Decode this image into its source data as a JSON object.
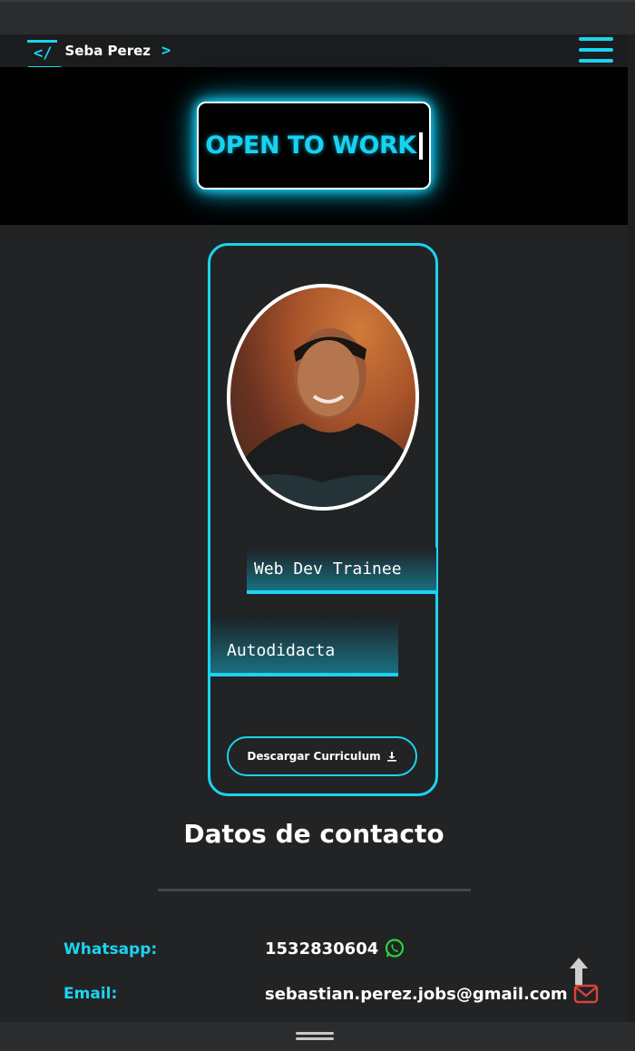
{
  "navbar": {
    "brand_open": "</",
    "brand_name": "Seba Perez",
    "brand_close": ">",
    "menu_icon": "hamburger-menu-icon"
  },
  "hero": {
    "headline": "OPEN TO WORK"
  },
  "profile": {
    "tag_role": "Web Dev Trainee",
    "tag_trait": "Autodidacta",
    "download_label": "Descargar Curriculum",
    "download_icon": "download-icon"
  },
  "contact": {
    "title": "Datos de contacto",
    "whatsapp_label": "Whatsapp:",
    "whatsapp_value": "1532830604",
    "whatsapp_icon": "whatsapp-icon",
    "email_label": "Email:",
    "email_value": "sebastian.perez.jobs@gmail.com",
    "email_icon": "envelope-icon"
  },
  "colors": {
    "accent": "#1ad4f0",
    "background": "#222324",
    "whatsapp_green": "#29d43f",
    "email_red": "#d8423d"
  }
}
